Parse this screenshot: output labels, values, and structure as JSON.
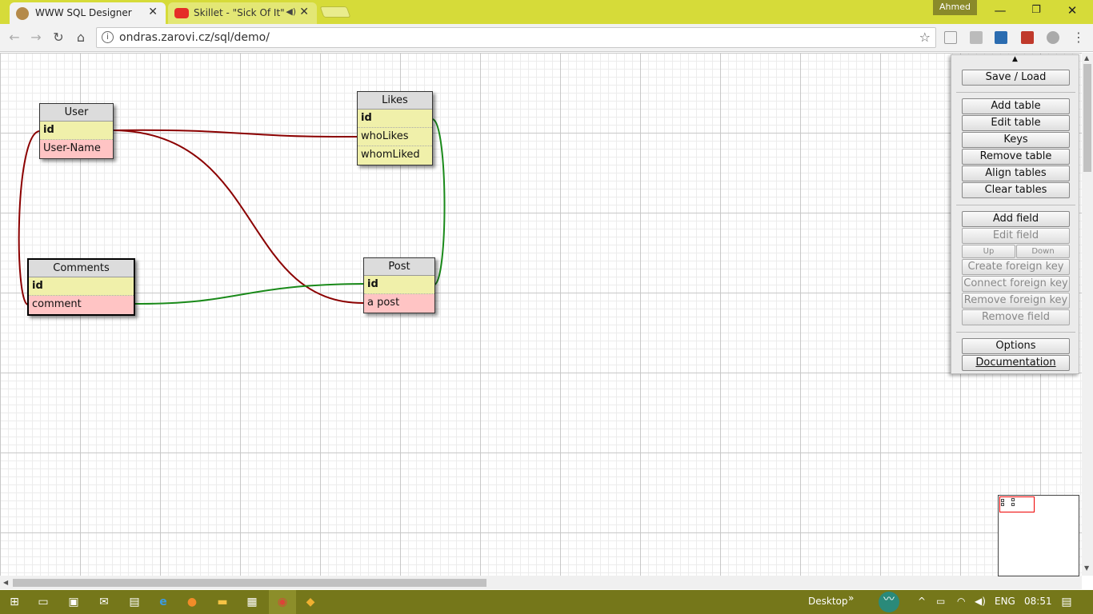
{
  "browser": {
    "tabs": [
      {
        "title": "WWW SQL Designer",
        "active": true
      },
      {
        "title": "Skillet - \"Sick Of It\" Of",
        "active": false
      }
    ],
    "profile_name": "Ahmed",
    "url": "ondras.zarovi.cz/sql/demo/",
    "accent_color": "#d6db39"
  },
  "designer": {
    "tables": [
      {
        "name": "User",
        "rows": [
          {
            "label": "id",
            "kind": "pk"
          },
          {
            "label": "User-Name",
            "kind": "fk"
          }
        ]
      },
      {
        "name": "Likes",
        "rows": [
          {
            "label": "id",
            "kind": "pk"
          },
          {
            "label": "whoLikes",
            "kind": "normal"
          },
          {
            "label": "whomLiked",
            "kind": "normal"
          }
        ]
      },
      {
        "name": "Comments",
        "rows": [
          {
            "label": "id",
            "kind": "pk"
          },
          {
            "label": "comment",
            "kind": "fk"
          }
        ]
      },
      {
        "name": "Post",
        "rows": [
          {
            "label": "id",
            "kind": "pk"
          },
          {
            "label": "a post",
            "kind": "fk"
          }
        ]
      }
    ],
    "relation_colors": {
      "dark_red": "#8b0000",
      "green": "#1a8a1a"
    }
  },
  "panel": {
    "save_load": "Save / Load",
    "add_table": "Add table",
    "edit_table": "Edit table",
    "keys": "Keys",
    "remove_table": "Remove table",
    "align_tables": "Align tables",
    "clear_tables": "Clear tables",
    "add_field": "Add field",
    "edit_field": "Edit field",
    "up": "Up",
    "down": "Down",
    "create_fk": "Create foreign key",
    "connect_fk": "Connect foreign key",
    "remove_fk": "Remove foreign key",
    "remove_field": "Remove field",
    "options": "Options",
    "documentation": "Documentation"
  },
  "taskbar": {
    "desktop_label": "Desktop",
    "language": "ENG",
    "time": "08:51"
  }
}
